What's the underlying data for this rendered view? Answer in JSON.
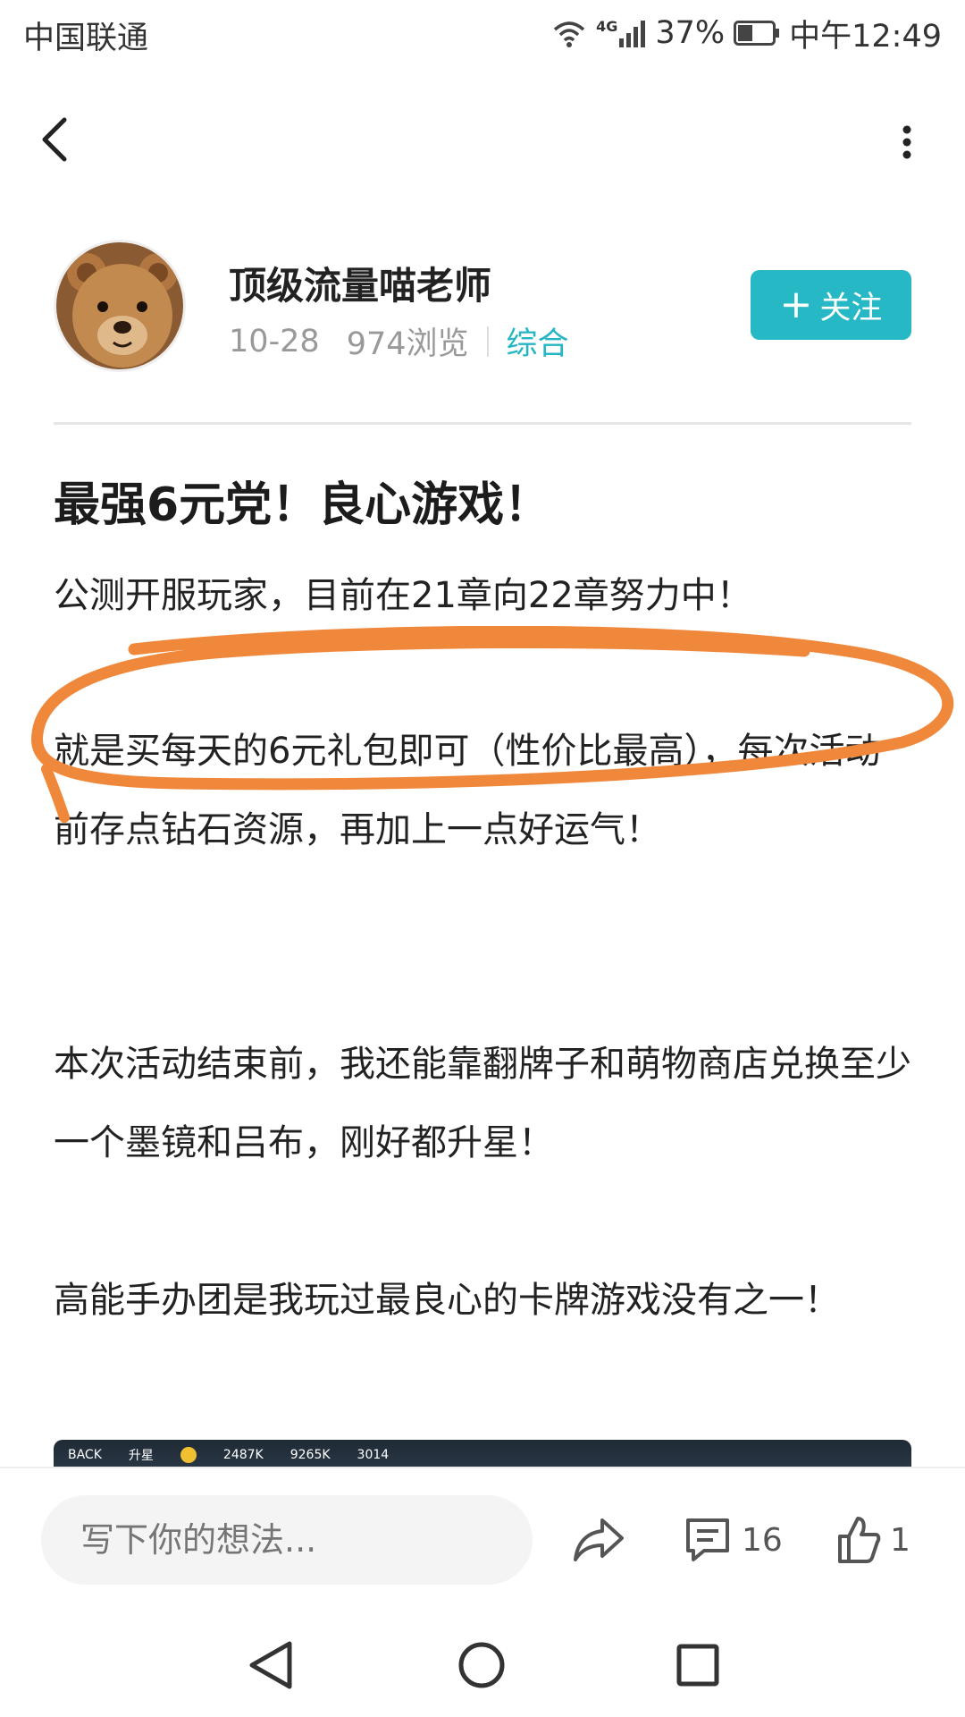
{
  "status_bar": {
    "carrier": "中国联通",
    "network": "4G",
    "battery": "37%",
    "time": "中午12:49"
  },
  "author": {
    "name": "顶级流量喵老师",
    "date": "10-28",
    "views": "974浏览",
    "category": "综合",
    "follow_label": "关注"
  },
  "article": {
    "title": "最强6元党！良心游戏！",
    "paragraphs": [
      "公测开服玩家，目前在21章向22章努力中！",
      "就是买每天的6元礼包即可（性价比最高），每次活动前存点钻石资源，再加上一点好运气！",
      "本次活动结束前，我还能靠翻牌子和萌物商店兑换至少一个墨镜和吕布，刚好都升星！",
      "高能手办团是我玩过最良心的卡牌游戏没有之一！"
    ],
    "image_strip": {
      "back_label": "BACK",
      "section": "升星",
      "stat1": "2487K",
      "stat2": "9265K",
      "stat3": "3014"
    },
    "annotation_color": "#f0883c"
  },
  "action_bar": {
    "comment_placeholder": "写下你的想法...",
    "comment_count": "16",
    "like_count": "1"
  },
  "colors": {
    "accent": "#26b8c4"
  }
}
